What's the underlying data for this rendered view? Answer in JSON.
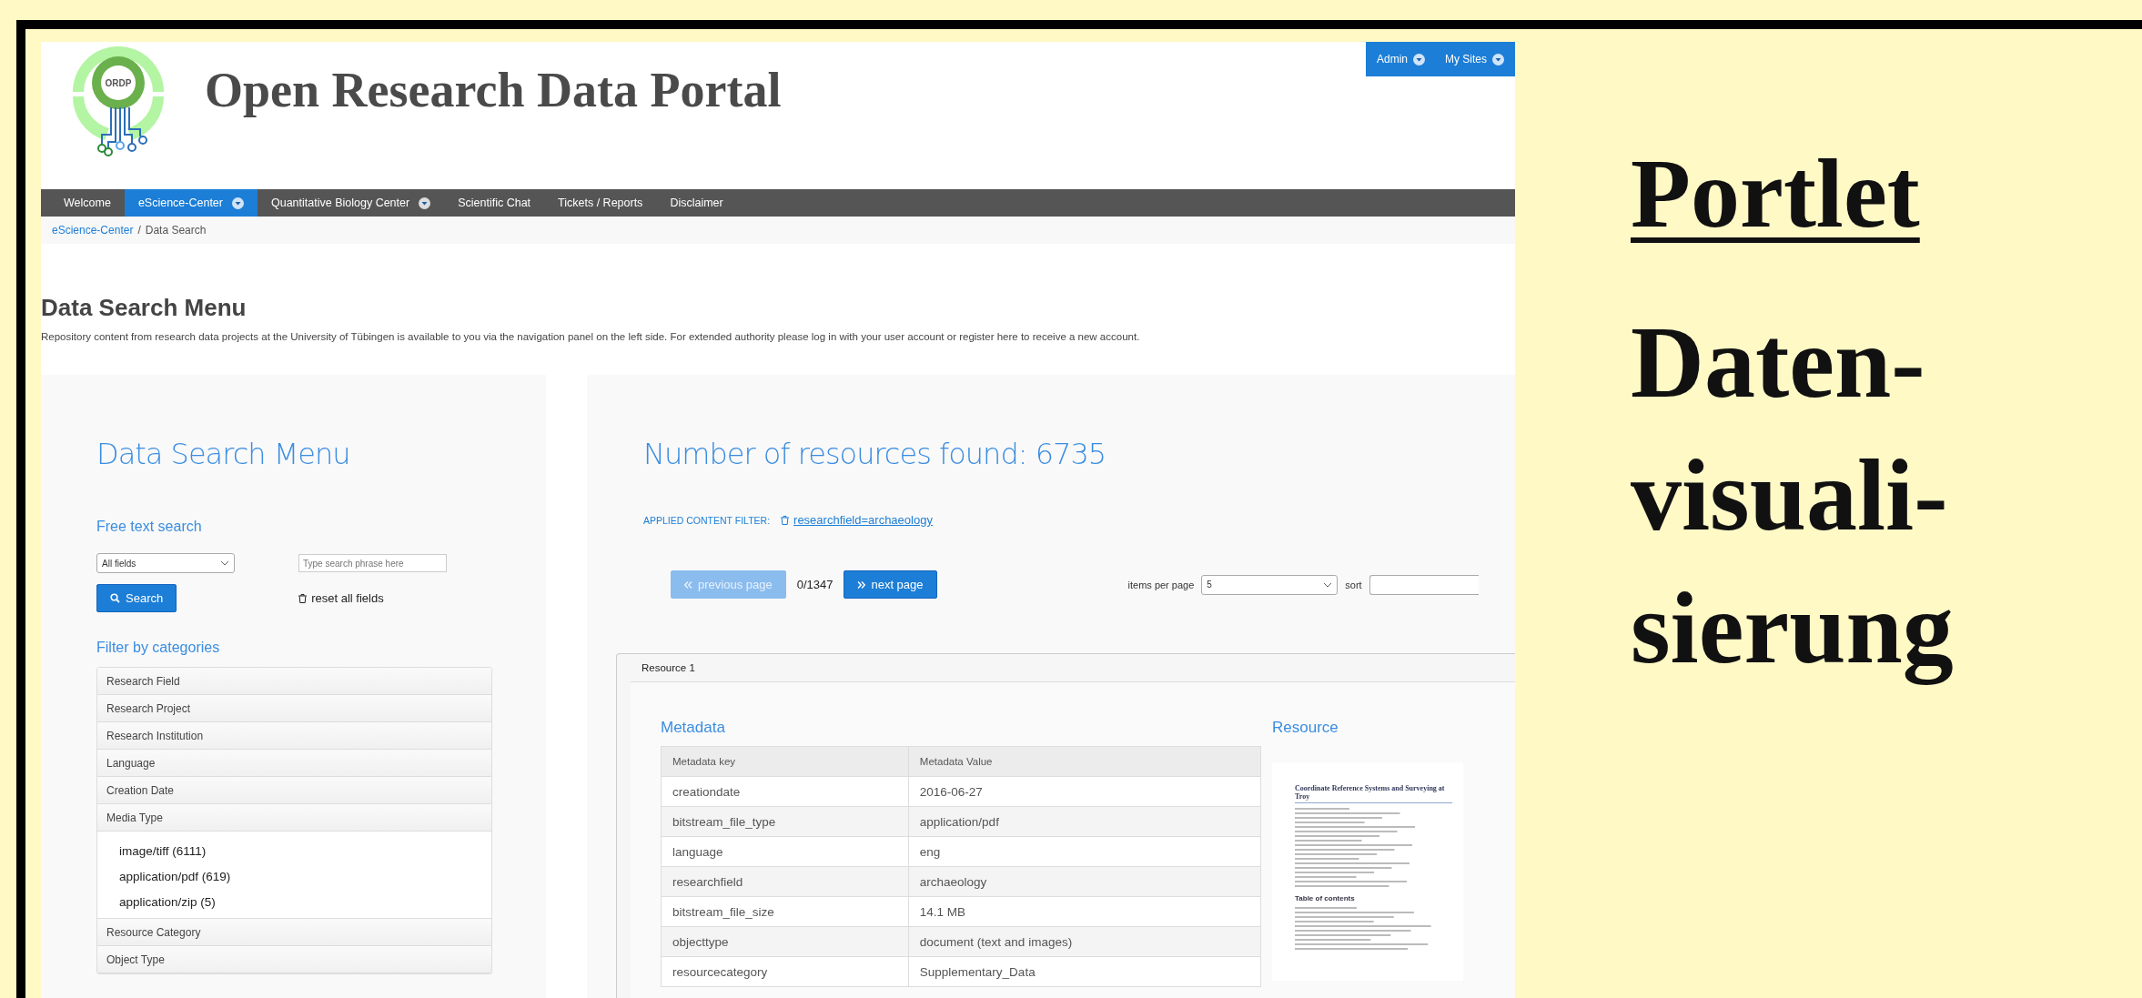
{
  "slide": {
    "heading": "Portlet",
    "lines": [
      "Daten-",
      "visuali-",
      "sierung"
    ]
  },
  "portal": {
    "title": "Open Research Data Portal",
    "logo_text": "ORDP",
    "user_menu": [
      {
        "label": "Admin",
        "has_dropdown": true
      },
      {
        "label": "My Sites",
        "has_dropdown": true
      }
    ],
    "nav": [
      {
        "label": "Welcome",
        "selected": false,
        "has_dropdown": false
      },
      {
        "label": "eScience-Center",
        "selected": true,
        "has_dropdown": true
      },
      {
        "label": "Quantitative Biology Center",
        "selected": false,
        "has_dropdown": true
      },
      {
        "label": "Scientific Chat",
        "selected": false,
        "has_dropdown": false
      },
      {
        "label": "Tickets / Reports",
        "selected": false,
        "has_dropdown": false
      },
      {
        "label": "Disclaimer",
        "selected": false,
        "has_dropdown": false
      }
    ],
    "breadcrumb": {
      "link": "eScience-Center",
      "separator": "/",
      "current": "Data Search"
    },
    "page_heading": "Data Search Menu",
    "intro": "Repository content from research data projects at the University of Tübingen is available to you via the navigation panel on the left side. For extended authority please log in with your user account or register here to receive a new account.",
    "search_menu": {
      "heading": "Data Search Menu",
      "free_text_label": "Free text search",
      "field_select": "All fields",
      "search_placeholder": "Type search phrase here",
      "search_button": "Search",
      "reset_button": "reset all fields",
      "filter_label": "Filter by categories",
      "categories": [
        {
          "label": "Research Field"
        },
        {
          "label": "Research Project"
        },
        {
          "label": "Research Institution"
        },
        {
          "label": "Language"
        },
        {
          "label": "Creation Date"
        },
        {
          "label": "Media Type",
          "options": [
            "image/tiff (6111)",
            "application/pdf (619)",
            "application/zip (5)"
          ]
        },
        {
          "label": "Resource Category"
        },
        {
          "label": "Object Type"
        }
      ]
    },
    "results": {
      "heading": "Number of resources found: 6735",
      "filter_label": "APPLIED CONTENT FILTER:",
      "filter_value": "researchfield=archaeology",
      "prev_button": {
        "label": "previous page",
        "disabled": true
      },
      "page_count": "0/1347",
      "next_button": {
        "label": "next page",
        "disabled": false
      },
      "items_per_page_label": "items per page",
      "items_per_page": "5",
      "sort_label": "sort",
      "resource": {
        "tab": "Resource 1",
        "metadata_heading": "Metadata",
        "resource_heading": "Resource",
        "columns": [
          "Metadata key",
          "Metadata Value"
        ],
        "rows": [
          [
            "creationdate",
            "2016-06-27"
          ],
          [
            "bitstream_file_type",
            "application/pdf"
          ],
          [
            "language",
            "eng"
          ],
          [
            "researchfield",
            "archaeology"
          ],
          [
            "bitstream_file_size",
            "14.1 MB"
          ],
          [
            "objecttype",
            "document (text and images)"
          ],
          [
            "resourcecategory",
            "Supplementary_Data"
          ]
        ],
        "preview_title": "Coordinate Reference Systems and Surveying at Troy",
        "preview_toc": "Table of contents"
      }
    }
  }
}
